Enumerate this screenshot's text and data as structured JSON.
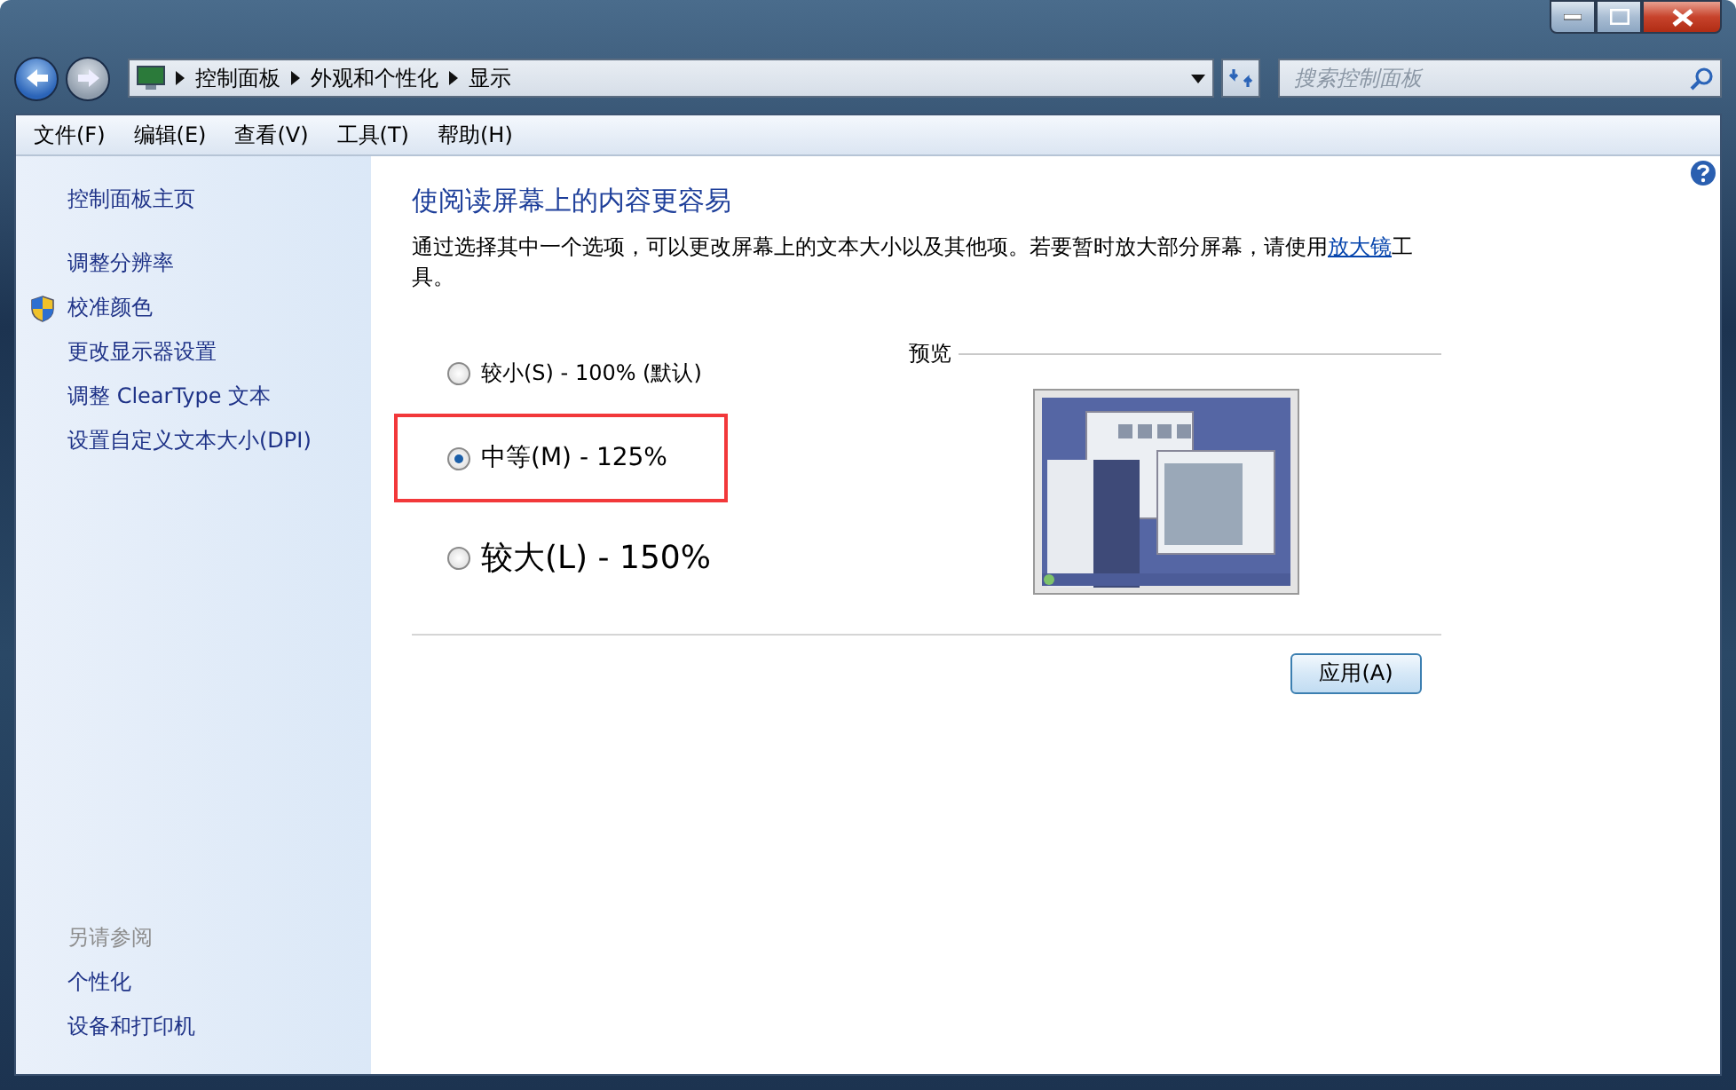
{
  "address_bar": {
    "breadcrumbs": [
      "控制面板",
      "外观和个性化",
      "显示"
    ]
  },
  "search": {
    "placeholder": "搜索控制面板"
  },
  "menu": [
    "文件(F)",
    "编辑(E)",
    "查看(V)",
    "工具(T)",
    "帮助(H)"
  ],
  "sidebar": {
    "items": [
      {
        "label": "控制面板主页",
        "kind": "home"
      },
      {
        "label": "调整分辨率",
        "kind": "link"
      },
      {
        "label": "校准颜色",
        "kind": "admin"
      },
      {
        "label": "更改显示器设置",
        "kind": "link"
      },
      {
        "label": "调整 ClearType 文本",
        "kind": "link"
      },
      {
        "label": "设置自定义文本大小(DPI)",
        "kind": "link"
      }
    ],
    "see_also": {
      "title": "另请参阅",
      "items": [
        "个性化",
        "设备和打印机"
      ]
    }
  },
  "main": {
    "heading": "使阅读屏幕上的内容更容易",
    "description": {
      "before": "通过选择其中一个选项，可以更改屏幕上的文本大小以及其他项。若要暂时放大部分屏幕，请使用",
      "link": "放大镜",
      "after": "工具。"
    },
    "options": [
      {
        "label": "较小(S) - 100% (默认)",
        "kind": "small",
        "selected": false,
        "highlighted": false
      },
      {
        "label": "中等(M) - 125%",
        "kind": "medium",
        "selected": true,
        "highlighted": true
      },
      {
        "label": "较大(L) - 150%",
        "kind": "large",
        "selected": false,
        "highlighted": false
      }
    ],
    "preview_label": "预览",
    "apply_button": "应用(A)"
  }
}
